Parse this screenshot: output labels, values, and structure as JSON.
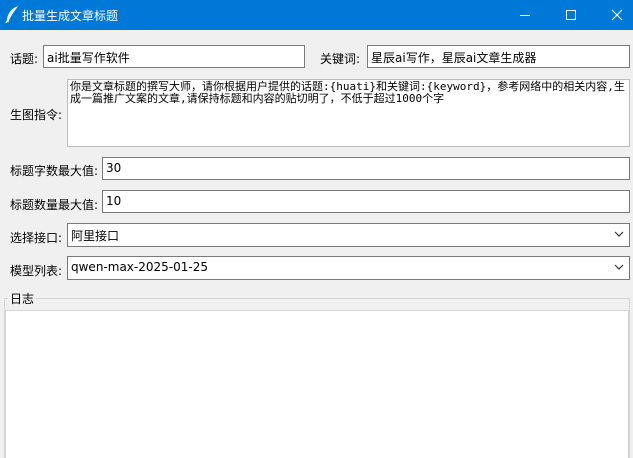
{
  "window": {
    "title": "批量生成文章标题",
    "icons": {
      "app": "feather-icon",
      "minimize": "minimize-icon",
      "maximize": "maximize-icon",
      "close": "close-icon"
    },
    "accent": "#0078d7"
  },
  "form": {
    "topic": {
      "label": "话题:",
      "value": "ai批量写作软件"
    },
    "keywords": {
      "label": "关键词:",
      "value": "星辰ai写作，星辰ai文章生成器"
    },
    "prompt": {
      "label": "生图指令:",
      "value": "你是文章标题的撰写大师，请你根据用户提供的话题:{huati}和关键词:{keyword}，参考网络中的相关内容,生成一篇推广文案的文章,请保持标题和内容的贴切明了，不低于超过1000个字"
    },
    "title_max_chars": {
      "label": "标题字数最大值:",
      "value": "30"
    },
    "title_max_count": {
      "label": "标题数量最大值:",
      "value": "10"
    },
    "api": {
      "label": "选择接口:",
      "selected": "阿里接口"
    },
    "model": {
      "label": "模型列表:",
      "selected": "qwen-max-2025-01-25"
    }
  },
  "log": {
    "label": "日志",
    "content": ""
  }
}
